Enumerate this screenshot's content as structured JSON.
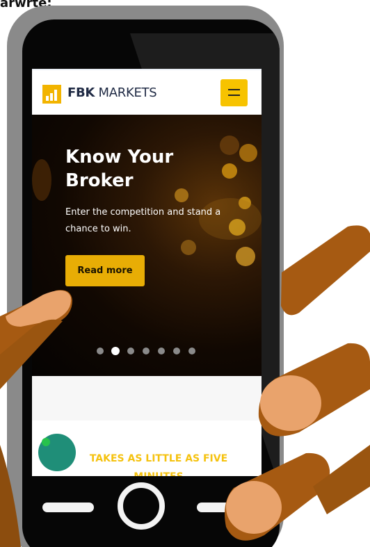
{
  "caption_fragment": "arwrte:",
  "screen": {
    "logo": {
      "brand_bold": "FBK",
      "brand_rest": " MARKETS"
    },
    "menu_button": {
      "icon": "hamburger-icon"
    },
    "hero": {
      "title": "Know Your Broker",
      "subtitle": "Enter the competition and stand a chance to win.",
      "cta_label": "Read more",
      "carousel": {
        "total": 7,
        "active_index": 1
      }
    },
    "section": {
      "headline": "TAKES AS LITTLE AS FIVE MINUTES"
    },
    "chat_widget": {
      "icon": "chat-bubble-icon"
    }
  },
  "colors": {
    "accent_yellow": "#F7C300",
    "button_gold": "#E8AD05",
    "headline_yellow": "#F5C20F",
    "brand_navy": "#1F2A44",
    "chat_teal": "#1F8E78",
    "skin_brown": "#A65A12"
  }
}
